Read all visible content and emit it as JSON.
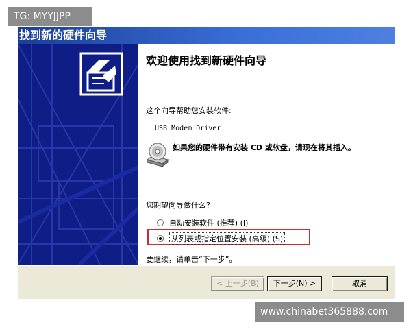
{
  "watermark": {
    "top_label": "TG: MYYJJPP",
    "bottom_label": "www.chinabet365888.com"
  },
  "window": {
    "title": "找到新的硬件向导"
  },
  "wizard": {
    "heading": "欢迎使用找到新硬件向导",
    "intro": "这个向导帮助您安装软件:",
    "device": "USB Modem Driver",
    "cd_notice": "如果您的硬件带有安装 CD 或软盘，请现在将其插入。",
    "question": "您期望向导做什么?",
    "options": [
      {
        "label": "自动安装软件 (推荐) (I)",
        "selected": false
      },
      {
        "label": "从列表或指定位置安装 (高级) (S)",
        "selected": true
      }
    ],
    "continue_hint": "要继续，请单击“下一步”。"
  },
  "buttons": {
    "back": "< 上一步(B)",
    "next": "下一步(N) >",
    "cancel": "取消"
  },
  "colors": {
    "sidebar": "#0f1e86",
    "title_bar": "#1b3f98",
    "highlight_box": "#c8302a",
    "dialog_face": "#ece9d8"
  },
  "icons": {
    "sidebar": "hardware-wizard-icon",
    "notice": "cd-disk-icon"
  }
}
